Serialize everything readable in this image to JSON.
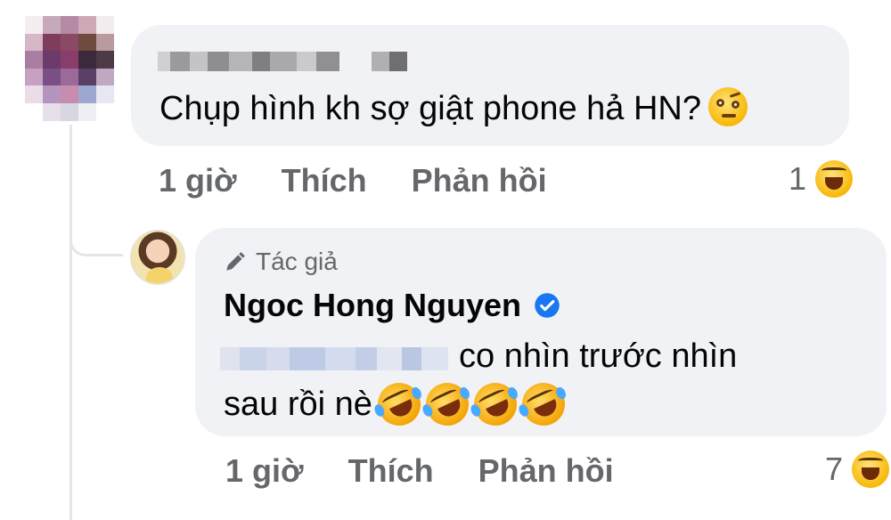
{
  "comment1": {
    "text": "Chụp hình kh sợ giật phone hả HN?",
    "emoji": "face-with-raised-eyebrow",
    "time": "1 giờ",
    "like_label": "Thích",
    "reply_label": "Phản hồi",
    "reaction_count": "1",
    "reaction_icon": "haha-reaction"
  },
  "reply": {
    "badge_label": "Tác giả",
    "author_name": "Ngoc Hong Nguyen",
    "text_line1": "co nhìn trước nhìn",
    "text_line2": "sau rồi nè",
    "emojis": [
      "rofl",
      "rofl",
      "rofl",
      "rofl"
    ],
    "time": "1 giờ",
    "like_label": "Thích",
    "reply_label": "Phản hồi",
    "reaction_count": "7",
    "reaction_icon": "haha-reaction"
  },
  "colors": {
    "bubble_bg": "#f0f2f5",
    "secondary_text": "#65676b",
    "primary_text": "#050505",
    "verified_blue": "#1877f2",
    "thread_line": "#e4e6ea"
  }
}
